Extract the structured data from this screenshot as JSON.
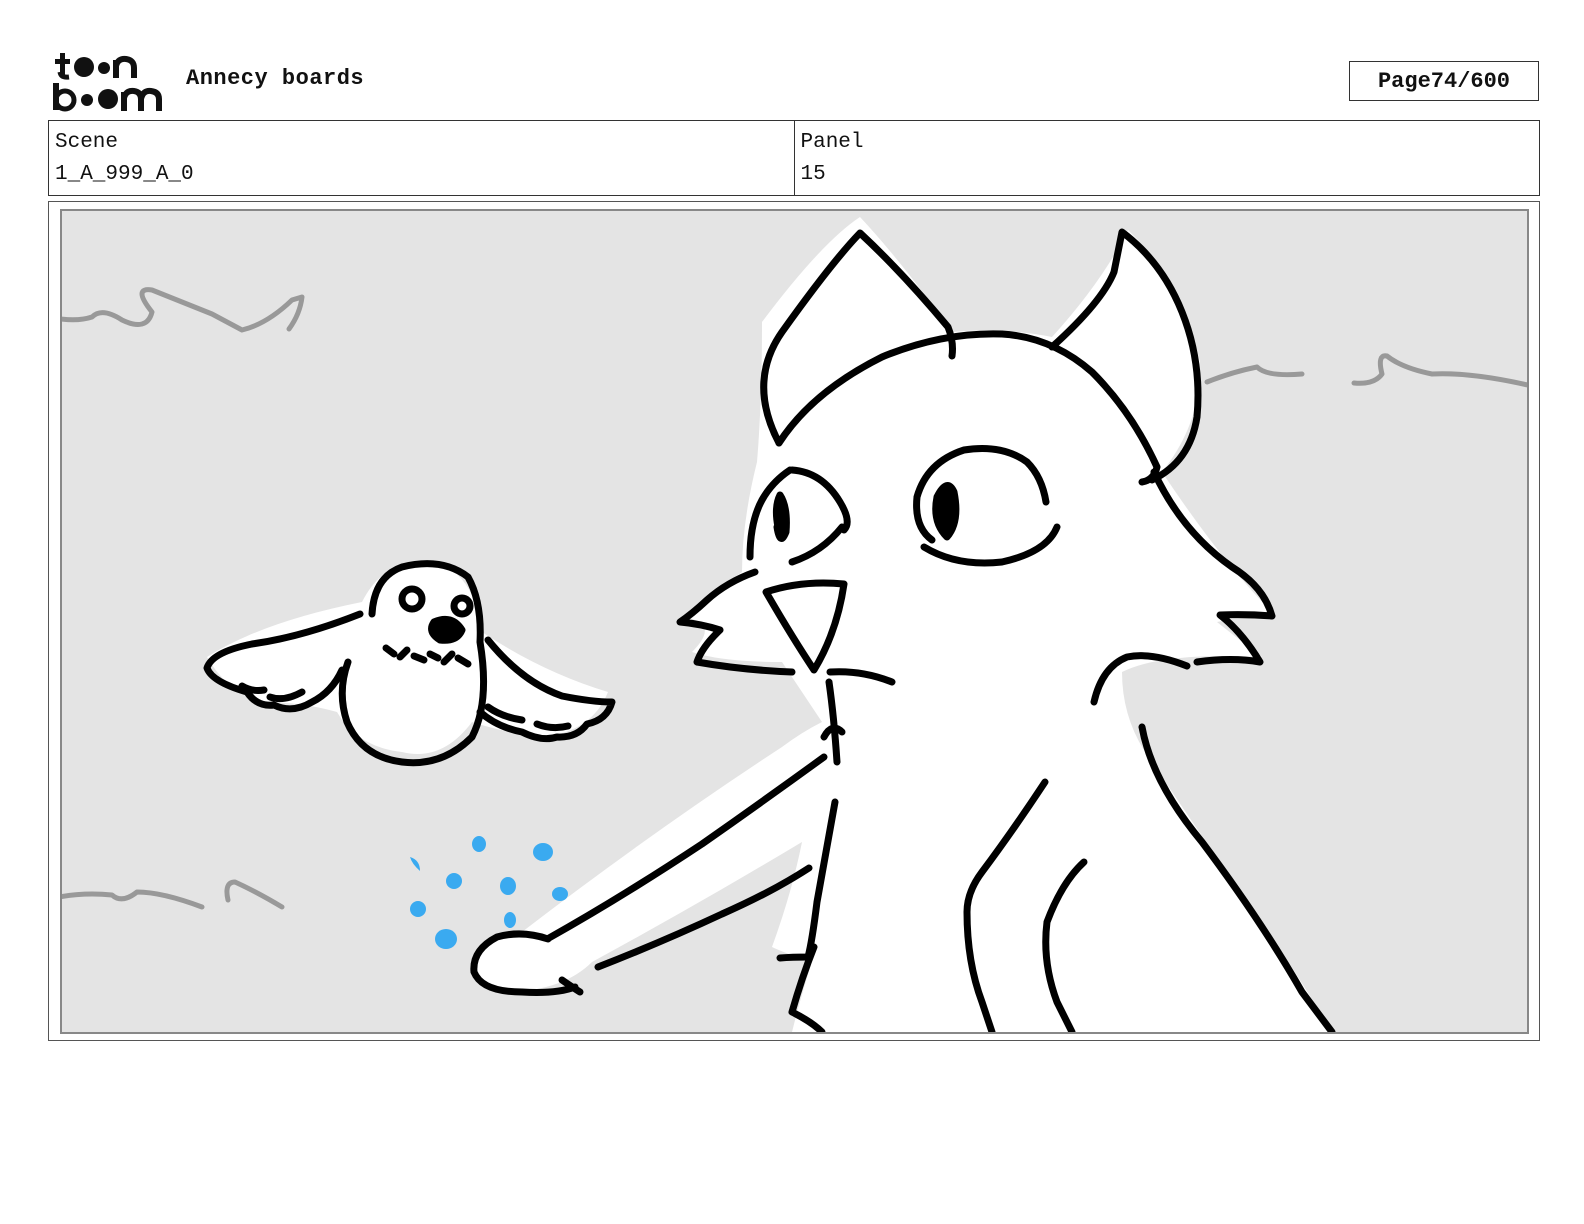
{
  "header": {
    "logo_text": "toon boom",
    "project_title": "Annecy boards",
    "page_label": "Page",
    "page_number": "74/600"
  },
  "info": {
    "scene_label": "Scene",
    "scene_value": "1_A_999_A_0",
    "panel_label": "Panel",
    "panel_value": "15"
  },
  "drawing": {
    "background_color": "#e4e4e4",
    "line_color": "#000000",
    "cloud_color": "#999999",
    "seed_color": "#3aaaf0"
  }
}
